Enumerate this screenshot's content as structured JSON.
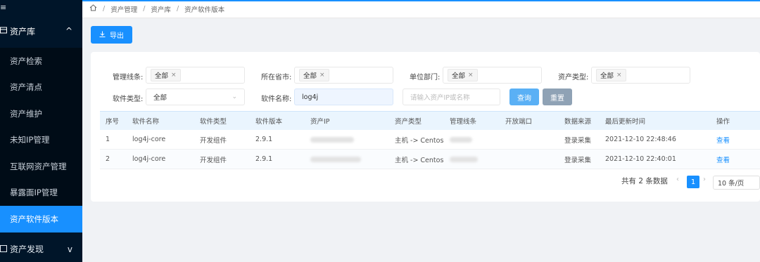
{
  "sidebar": {
    "top_icon": "≡",
    "section": {
      "label": "资产库",
      "icon": "library-icon",
      "chevron": "^"
    },
    "items": [
      {
        "label": "资产检索"
      },
      {
        "label": "资产清点"
      },
      {
        "label": "资产维护"
      },
      {
        "label": "未知IP管理"
      },
      {
        "label": "互联网资产管理"
      },
      {
        "label": "暴露面IP管理"
      },
      {
        "label": "资产软件版本",
        "active": true
      }
    ],
    "bottom": {
      "label": "资产发现",
      "chevron": "v"
    }
  },
  "breadcrumb": {
    "home_icon": "home-icon",
    "items": [
      "资产管理",
      "资产库",
      "资产软件版本"
    ]
  },
  "toolbar": {
    "export_label": "导出",
    "export_icon": "download-icon"
  },
  "filters": {
    "management_line": {
      "label": "管理线条:",
      "tag": "全部"
    },
    "province_city": {
      "label": "所在省市:",
      "tag": "全部"
    },
    "department": {
      "label": "单位部门:",
      "tag": "全部"
    },
    "asset_type": {
      "label": "资产类型:",
      "tag": "全部"
    },
    "software_type": {
      "label": "软件类型:",
      "value": "全部"
    },
    "software_name": {
      "label": "软件名称:",
      "value": "log4j"
    },
    "search_placeholder": "请输入资产IP或名称",
    "query_label": "查询",
    "reset_label": "重置"
  },
  "table": {
    "headers": [
      "序号",
      "软件名称",
      "软件类型",
      "软件版本",
      "资产IP",
      "资产类型",
      "管理线条",
      "开放端口",
      "数据来源",
      "最后更新时间",
      "操作"
    ],
    "rows": [
      {
        "index": "1",
        "name": "log4j-core",
        "type": "开发组件",
        "version": "2.9.1",
        "asset_type": "主机 -> Centos",
        "source": "登录采集",
        "updated": "2021-12-10 22:48:46",
        "action": "查看"
      },
      {
        "index": "2",
        "name": "log4j-core",
        "type": "开发组件",
        "version": "2.9.1",
        "asset_type": "主机 -> Centos",
        "source": "登录采集",
        "updated": "2021-12-10 22:40:01",
        "action": "查看"
      }
    ]
  },
  "pagination": {
    "total_text": "共有 2 条数据",
    "current_page": "1",
    "page_size": "10 条/页"
  },
  "colors": {
    "sidebar_bg": "#001529",
    "accent": "#1890ff"
  }
}
